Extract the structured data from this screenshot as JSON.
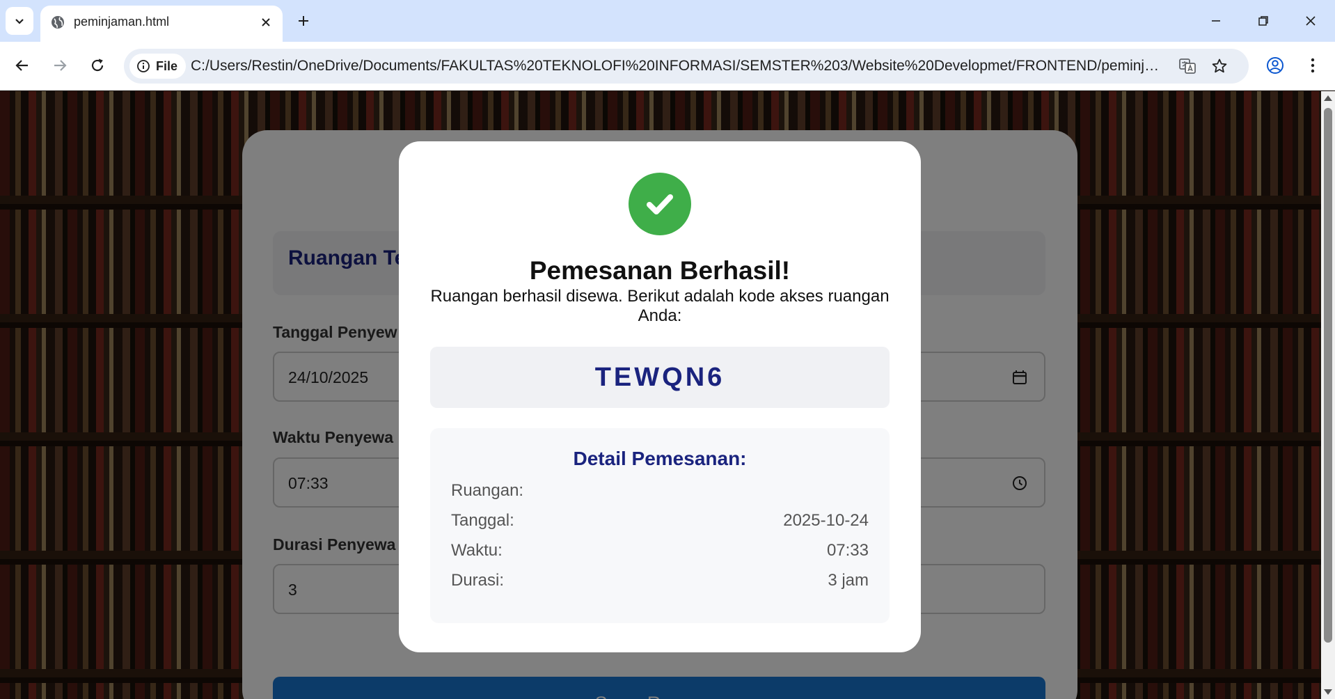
{
  "browser": {
    "tab_title": "peminjaman.html",
    "site_chip_label": "File",
    "url": "C:/Users/Restin/OneDrive/Documents/FAKULTAS%20TEKNOLOFI%20INFORMASI/SEMSTER%203/Website%20Developmet/FRONTEND/peminjaman.ht..."
  },
  "form": {
    "room_title": "Ruangan Te",
    "date_label": "Tanggal Penyew",
    "date_value": "24/10/2025",
    "time_label": "Waktu Penyewa",
    "time_value": "07:33",
    "duration_label": "Durasi Penyewa",
    "duration_value": "3",
    "submit_label": "Sewa Ruangan"
  },
  "modal": {
    "title": "Pemesanan Berhasil!",
    "description": "Ruangan berhasil disewa. Berikut adalah kode akses ruangan Anda:",
    "access_code": "TEWQN6",
    "detail_title": "Detail Pemesanan:",
    "details": [
      {
        "key": "Ruangan:",
        "value": ""
      },
      {
        "key": "Tanggal:",
        "value": "2025-10-24"
      },
      {
        "key": "Waktu:",
        "value": "07:33"
      },
      {
        "key": "Durasi:",
        "value": "3 jam"
      }
    ]
  },
  "colors": {
    "success": "#3fae49",
    "accent": "#1a237e",
    "button": "#1976d2",
    "tabbar": "#d3e3fd"
  }
}
